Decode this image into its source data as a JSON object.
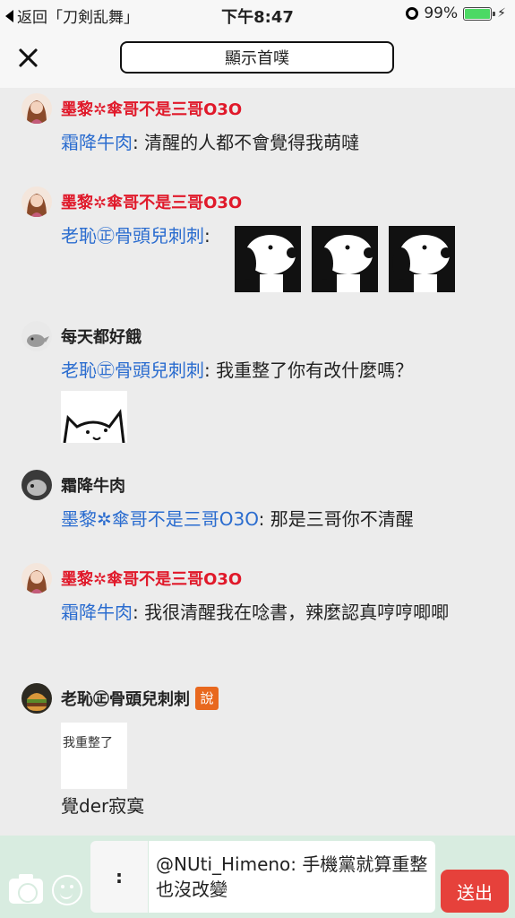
{
  "status_bar": {
    "back_label": "返回「刀剣乱舞」",
    "time": "下午8:47",
    "battery": "99%"
  },
  "header": {
    "show_first_label": "顯示首噗"
  },
  "messages": [
    {
      "user": "墨黎✲傘哥不是三哥O3O",
      "reply_to": "霜降牛肉",
      "text": "清醒的人都不會覺得我萌噠"
    },
    {
      "user": "墨黎✲傘哥不是三哥O3O",
      "reply_to": "老恥㊣骨頭兒刺刺",
      "text": ""
    },
    {
      "user": "每天都好餓",
      "reply_to": "老恥㊣骨頭兒刺刺",
      "text": "我重整了你有改什麼嗎？"
    },
    {
      "user": "霜降牛肉",
      "reply_to": "墨黎✲傘哥不是三哥O3O",
      "text": "那是三哥你不清醒"
    },
    {
      "user": "墨黎✲傘哥不是三哥O3O",
      "reply_to": "霜降牛肉",
      "text": "我很清醒我在唸書，辣麼認真哼哼唧唧"
    },
    {
      "user": "老恥㊣骨頭兒刺刺",
      "badge": "說",
      "image_text": "我重整了",
      "text": "覺der寂寞"
    }
  ],
  "input_bar": {
    "prefix": ":",
    "value": "@NUti_Himeno: 手機黨就算重整也沒改變",
    "send_label": "送出"
  }
}
